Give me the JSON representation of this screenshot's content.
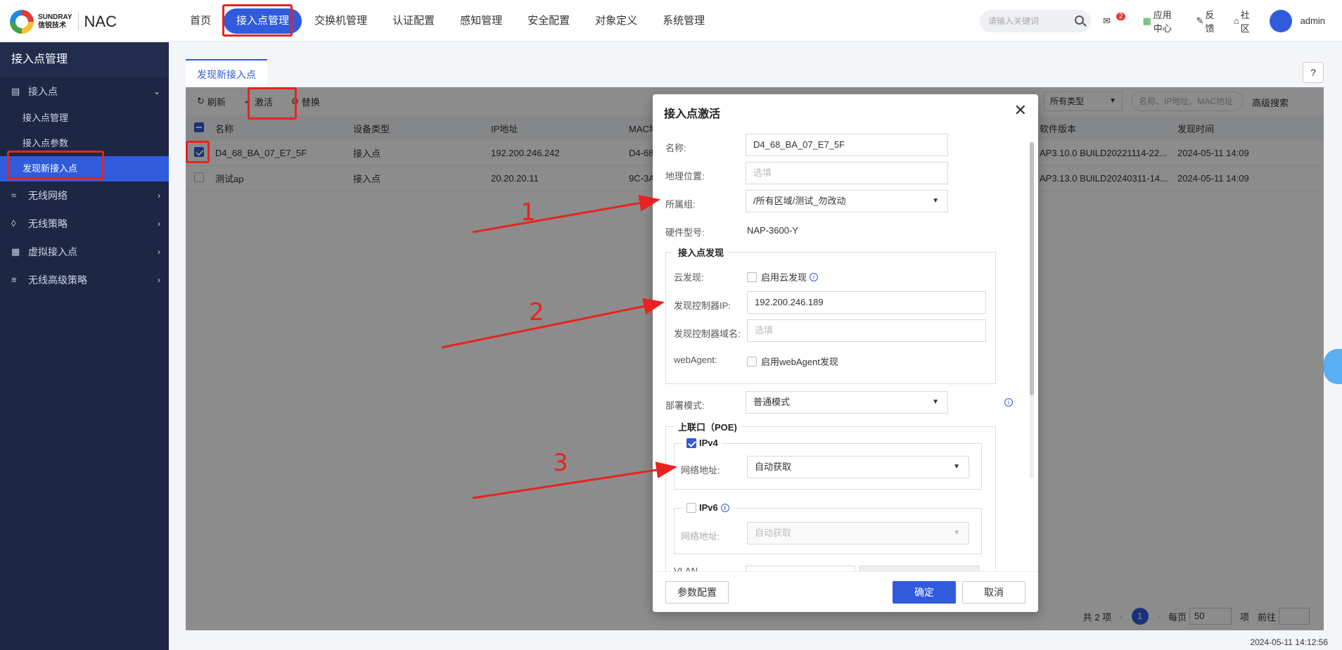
{
  "brand": {
    "company_en": "SUNDRAY",
    "company_cn": "信锐技术",
    "product": "NAC"
  },
  "nav": [
    {
      "label": "首页",
      "active": false
    },
    {
      "label": "接入点管理",
      "active": true
    },
    {
      "label": "交换机管理",
      "active": false
    },
    {
      "label": "认证配置",
      "active": false
    },
    {
      "label": "感知管理",
      "active": false
    },
    {
      "label": "安全配置",
      "active": false
    },
    {
      "label": "对象定义",
      "active": false
    },
    {
      "label": "系统管理",
      "active": false
    }
  ],
  "search": {
    "placeholder": "请输入关键词"
  },
  "tools": {
    "message_count": "2",
    "app_center": "应用中心",
    "feedback": "反馈",
    "community": "社区",
    "user": "admin"
  },
  "sidebar": {
    "title": "接入点管理",
    "items": [
      {
        "label": "接入点",
        "icon": "router-icon",
        "expanded": true,
        "children": [
          {
            "label": "接入点管理"
          },
          {
            "label": "接入点参数"
          },
          {
            "label": "发现新接入点",
            "active": true
          }
        ]
      },
      {
        "label": "无线网络",
        "icon": "wifi-icon"
      },
      {
        "label": "无线策略",
        "icon": "policy-icon"
      },
      {
        "label": "虚拟接入点",
        "icon": "grid-icon"
      },
      {
        "label": "无线高级策略",
        "icon": "advanced-icon"
      }
    ]
  },
  "tab": {
    "label": "发现新接入点"
  },
  "toolbar": {
    "refresh": "刷新",
    "activate": "激活",
    "replace": "替换",
    "type_filter": "所有类型",
    "search_placeholder": "名称、IP地址、MAC地址",
    "advanced": "高级搜索"
  },
  "table": {
    "headers": [
      "名称",
      "设备类型",
      "IP地址",
      "MAC地",
      "软件版本",
      "发现时间"
    ],
    "rows": [
      {
        "checked": true,
        "name": "D4_68_BA_07_E7_5F",
        "type": "接入点",
        "ip": "192.200.246.242",
        "mac": "D4-68",
        "version": "AP3.10.0 BUILD20221114-22...",
        "time": "2024-05-11 14:09"
      },
      {
        "checked": false,
        "name": "测试ap",
        "type": "接入点",
        "ip": "20.20.20.11",
        "mac": "9C-3A",
        "version": "AP3.13.0 BUILD20240311-14...",
        "time": "2024-05-11 14:09"
      }
    ]
  },
  "pagination": {
    "total": "共 2 项",
    "page": "1",
    "per_page_label": "每页",
    "per_page": "50",
    "unit": "项",
    "goto": "前往"
  },
  "clock": "2024-05-11 14:12:56",
  "dialog": {
    "title": "接入点激活",
    "name_label": "名称:",
    "name_value": "D4_68_BA_07_E7_5F",
    "location_label": "地理位置:",
    "location_placeholder": "选填",
    "group_label": "所属组:",
    "group_value": "/所有区域/测试_勿改动",
    "model_label": "硬件型号:",
    "model_value": "NAP-3600-Y",
    "discovery_legend": "接入点发现",
    "cloud_label": "云发现:",
    "cloud_check": "启用云发现",
    "controller_ip_label": "发现控制器IP:",
    "controller_ip_value": "192.200.246.189",
    "controller_domain_label": "发现控制器域名:",
    "controller_domain_placeholder": "选填",
    "webagent_label": "webAgent:",
    "webagent_check": "启用webAgent发现",
    "deploy_label": "部署模式:",
    "deploy_value": "普通模式",
    "uplink_legend": "上联口（POE)",
    "ipv4_label": "IPv4",
    "ipv4_net_label": "网络地址:",
    "ipv4_net_value": "自动获取",
    "ipv6_label": "IPv6",
    "ipv6_net_label": "网络地址:",
    "ipv6_net_value": "自动获取",
    "vlan_label": "VLAN",
    "param_button": "参数配置",
    "ok_button": "确定",
    "cancel_button": "取消"
  },
  "annotations": [
    "1",
    "2",
    "3"
  ],
  "colors": {
    "accent": "#2f5bdc",
    "sidebar": "#1d2744",
    "highlight": "#e8231f"
  }
}
